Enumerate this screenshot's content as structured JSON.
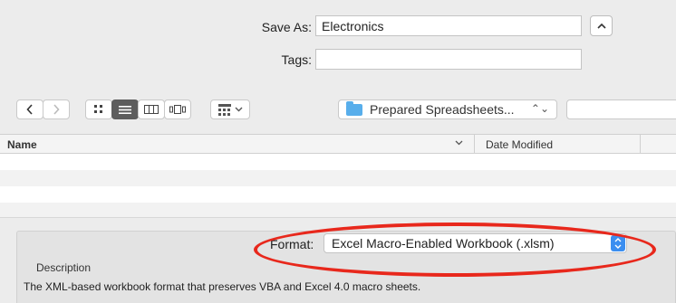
{
  "save_dialog": {
    "save_as_label": "Save As:",
    "save_as_value": "Electronics",
    "tags_label": "Tags:",
    "tags_value": "",
    "collapse_glyph": "^"
  },
  "toolbar": {
    "back_icon": "chevron-left-icon",
    "forward_icon": "chevron-right-icon",
    "view_icons": [
      "icon-view-icon",
      "list-view-icon",
      "column-view-icon",
      "cover-flow-icon"
    ],
    "selected_view": "list-view-icon",
    "arrange_icon": "arrange-icon",
    "location": "Prepared Spreadsheets...",
    "location_glyph": "⌃⌄"
  },
  "columns": {
    "name": "Name",
    "sort_glyph": "⌄",
    "date_modified": "Date Modified"
  },
  "accessory": {
    "format_label": "Format:",
    "format_value": "Excel Macro-Enabled Workbook (.xlsm)",
    "description_heading": "Description",
    "description_text": "The XML-based workbook format that preserves VBA and Excel 4.0 macro sheets."
  },
  "colors": {
    "window_bg": "#ececec",
    "highlight_ring": "#e8281c",
    "popup_accent": "#3b8ef0",
    "folder_blue": "#58aeeb"
  }
}
